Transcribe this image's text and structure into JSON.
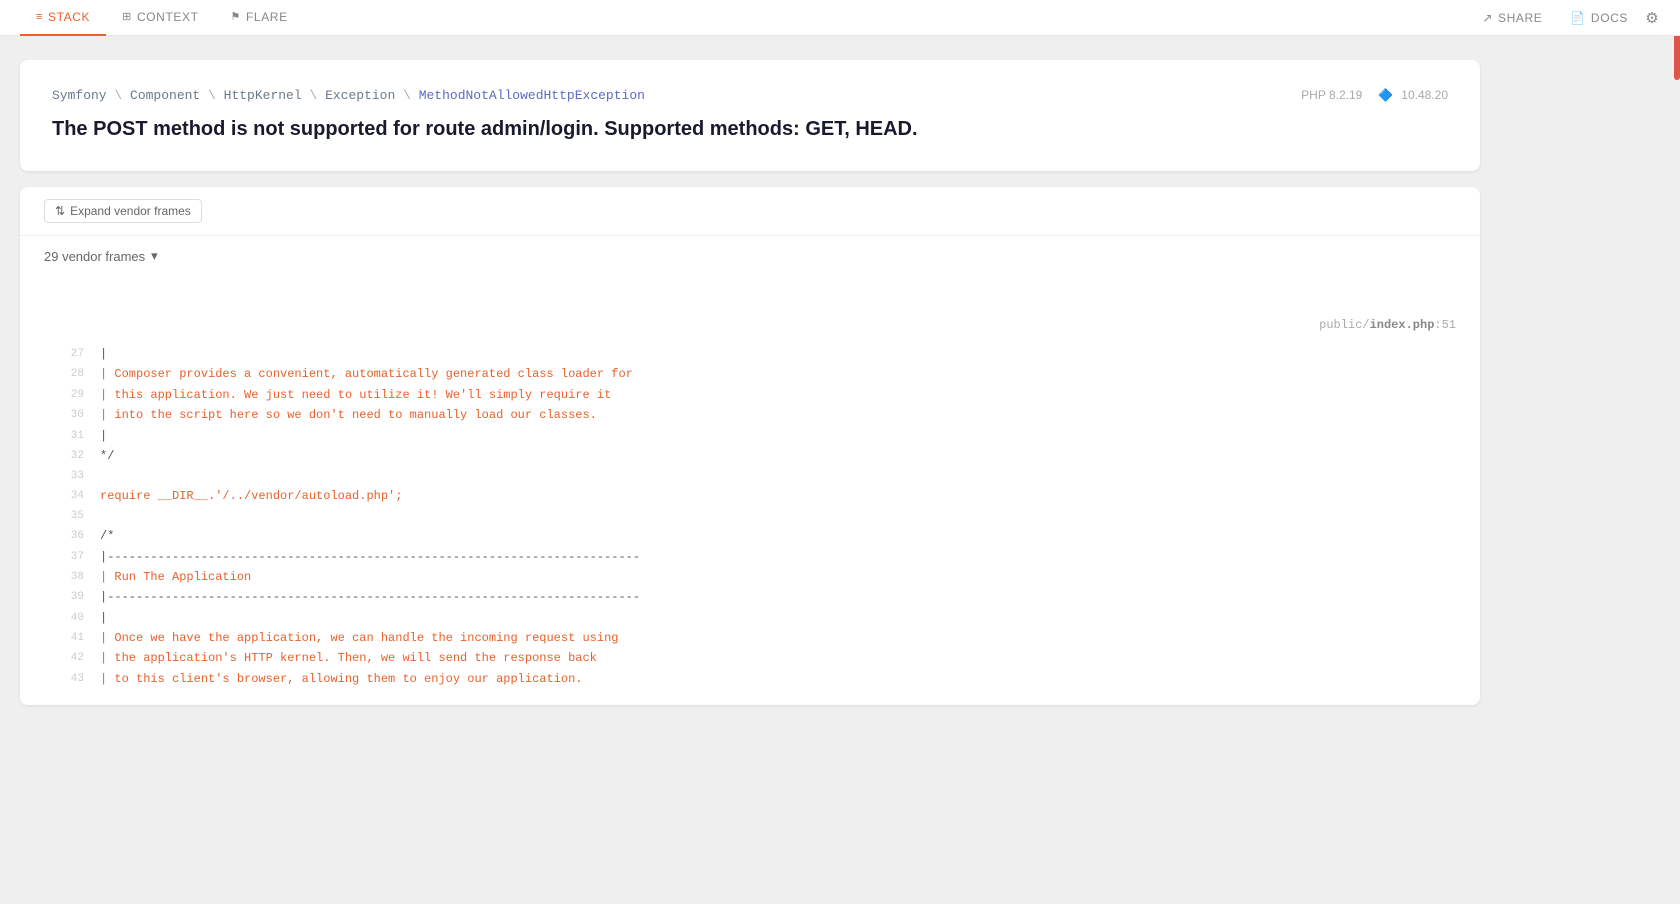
{
  "nav": {
    "items": [
      {
        "id": "stack",
        "label": "STACK",
        "icon": "≡",
        "active": true
      },
      {
        "id": "context",
        "label": "CONTEXT",
        "icon": "⊞",
        "active": false
      },
      {
        "id": "flare",
        "label": "FLARE",
        "icon": "⚑",
        "active": false
      }
    ],
    "right_items": [
      {
        "id": "share",
        "label": "SHARE",
        "icon": "↗"
      },
      {
        "id": "docs",
        "label": "DOCS",
        "icon": "📄"
      }
    ],
    "gear_label": "settings"
  },
  "error": {
    "exception_class": "Symfony\\Component\\HttpKernel\\Exception\\MethodNotAllowedHttpException",
    "exception_parts": [
      "Symfony",
      "Component",
      "HttpKernel",
      "Exception",
      "MethodNotAllowedHttpException"
    ],
    "message": "The POST method is not supported for route admin/login. Supported methods: GET, HEAD.",
    "php_version": "PHP 8.2.19",
    "laravel_version": "10.48.20"
  },
  "stack": {
    "expand_vendor_label": "Expand vendor frames",
    "vendor_frames_count": "29 vendor frames",
    "file_path": "public/",
    "file_name": "index.php",
    "file_line": "51",
    "code_lines": [
      {
        "number": "27",
        "content": "|",
        "highlighted": false
      },
      {
        "number": "28",
        "content": "| Composer provides a convenient, automatically generated class loader for",
        "highlighted": true
      },
      {
        "number": "29",
        "content": "| this application. We just need to utilize it! We'll simply require it",
        "highlighted": true
      },
      {
        "number": "30",
        "content": "| into the script here so we don't need to manually load our classes.",
        "highlighted": true
      },
      {
        "number": "31",
        "content": "|",
        "highlighted": false
      },
      {
        "number": "32",
        "content": "*/",
        "highlighted": false
      },
      {
        "number": "33",
        "content": "",
        "highlighted": false
      },
      {
        "number": "34",
        "content": "require __DIR__.'/../vendor/autoload.php';",
        "highlighted": true
      },
      {
        "number": "35",
        "content": "",
        "highlighted": false
      },
      {
        "number": "36",
        "content": "/*",
        "highlighted": false
      },
      {
        "number": "37",
        "content": "|--------------------------------------------------------------------------",
        "highlighted": false
      },
      {
        "number": "38",
        "content": "| Run The Application",
        "highlighted": true
      },
      {
        "number": "39",
        "content": "|--------------------------------------------------------------------------",
        "highlighted": false
      },
      {
        "number": "40",
        "content": "|",
        "highlighted": false
      },
      {
        "number": "41",
        "content": "| Once we have the application, we can handle the incoming request using",
        "highlighted": true
      },
      {
        "number": "42",
        "content": "| the application's HTTP kernel. Then, we will send the response back",
        "highlighted": true
      },
      {
        "number": "43",
        "content": "| to this client's browser, allowing them to enjoy our application.",
        "highlighted": true
      }
    ]
  }
}
